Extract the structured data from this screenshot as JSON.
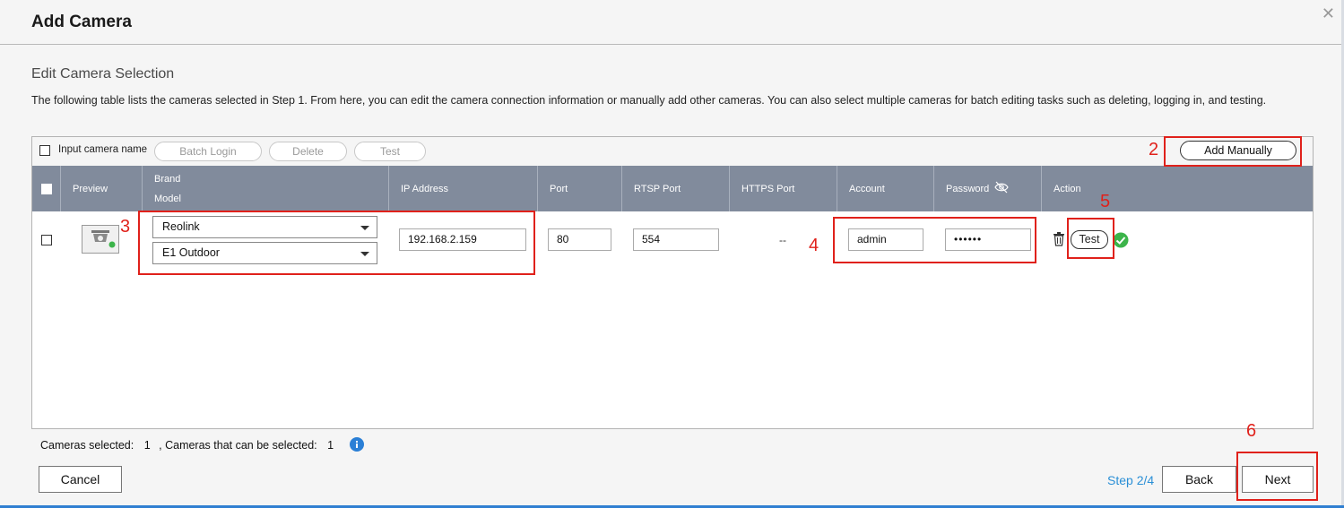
{
  "dialog": {
    "title": "Add Camera",
    "section_title": "Edit Camera Selection",
    "description": "The following table lists the cameras selected in Step 1. From here, you can edit the camera connection information or manually add other cameras. You can also select multiple cameras for batch editing tasks such as deleting, logging in, and testing."
  },
  "toolbar": {
    "input_camera_name_label": "Input camera name",
    "batch_login": "Batch Login",
    "delete": "Delete",
    "test": "Test",
    "add_manually": "Add Manually"
  },
  "table": {
    "headers": {
      "preview": "Preview",
      "brand": "Brand",
      "model": "Model",
      "ip_address": "IP Address",
      "port": "Port",
      "rtsp_port": "RTSP Port",
      "https_port": "HTTPS Port",
      "account": "Account",
      "password": "Password",
      "action": "Action"
    },
    "rows": [
      {
        "brand": "Reolink",
        "model": "E1 Outdoor",
        "ip_address": "192.168.2.159",
        "port": "80",
        "rtsp_port": "554",
        "https_port": "--",
        "account": "admin",
        "password": "••••••",
        "test_label": "Test",
        "status": "ok"
      }
    ]
  },
  "footer": {
    "cameras_selected_label": "Cameras selected:",
    "cameras_selected_value": "1",
    "cameras_can_select_label": ", Cameras that can be selected:",
    "cameras_can_select_value": "1",
    "cancel": "Cancel",
    "step": "Step 2/4",
    "back": "Back",
    "next": "Next"
  },
  "annotations": [
    "2",
    "3",
    "4",
    "5",
    "6"
  ],
  "colors": {
    "header_bg": "#818b9c",
    "annotation_red": "#e0211b",
    "step_blue": "#2a8fd6",
    "success_green": "#3cb44a",
    "info_blue": "#2a7fd6"
  }
}
